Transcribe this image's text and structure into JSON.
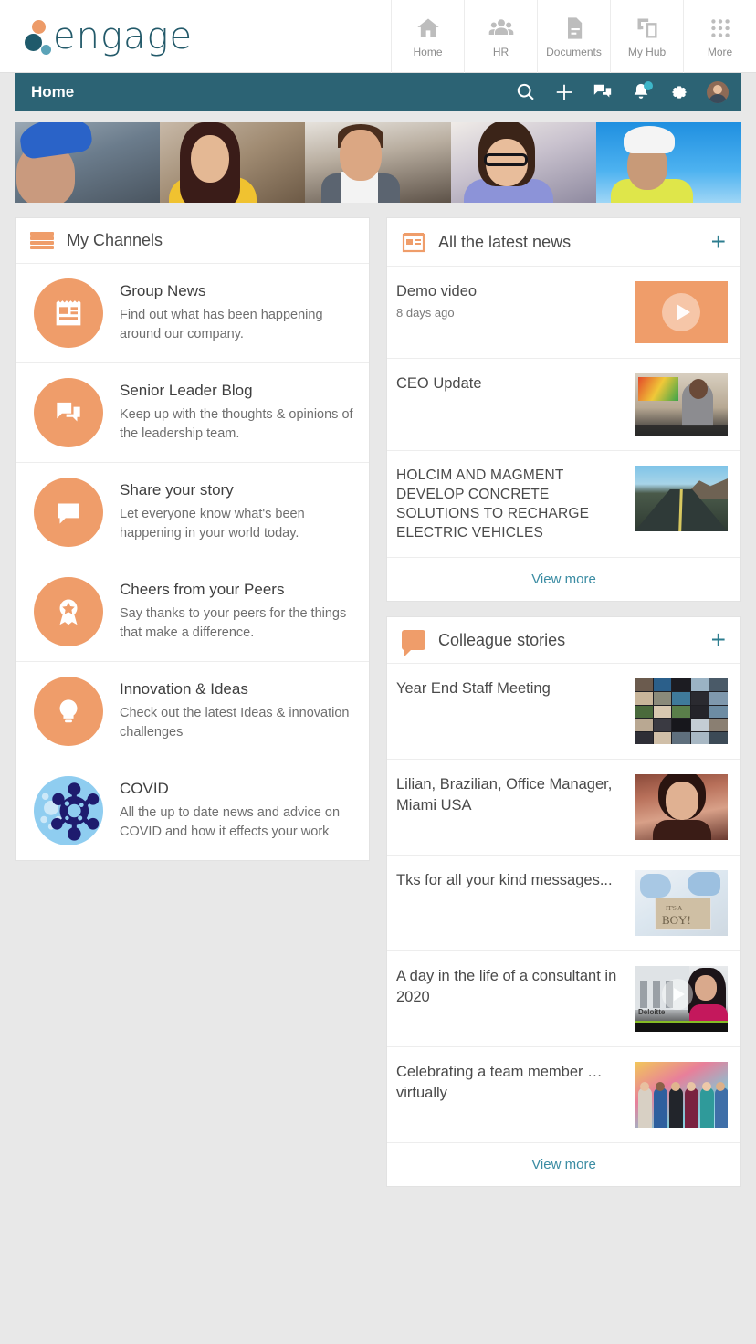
{
  "brand": {
    "name": "engage",
    "colors": {
      "orange": "#ef9d6a",
      "teal": "#2c6374",
      "link": "#3b8ca3",
      "covid_blue": "#8fcdf0"
    }
  },
  "topnav": [
    {
      "label": "Home",
      "icon": "home-icon"
    },
    {
      "label": "HR",
      "icon": "people-icon"
    },
    {
      "label": "Documents",
      "icon": "document-icon"
    },
    {
      "label": "My Hub",
      "icon": "hub-icon"
    },
    {
      "label": "More",
      "icon": "grid-dots-icon"
    }
  ],
  "pagebar": {
    "title": "Home",
    "actions": [
      {
        "name": "search-icon"
      },
      {
        "name": "add-icon"
      },
      {
        "name": "chat-icon"
      },
      {
        "name": "notifications-icon",
        "has_badge": true
      },
      {
        "name": "settings-icon"
      },
      {
        "name": "avatar"
      }
    ]
  },
  "my_channels": {
    "title": "My Channels",
    "icon": "hamburger-icon",
    "items": [
      {
        "name": "Group News",
        "desc": "Find out what has been happening around our company.",
        "icon": "newspaper-icon"
      },
      {
        "name": "Senior Leader Blog",
        "desc": "Keep up with the thoughts & opinions of the leadership team.",
        "icon": "chat-bubbles-icon"
      },
      {
        "name": "Share your story",
        "desc": "Let everyone know what's been happening in your world today.",
        "icon": "speech-bubble-icon"
      },
      {
        "name": "Cheers from your Peers",
        "desc": "Say thanks to your peers for the things that make a difference.",
        "icon": "award-rosette-icon"
      },
      {
        "name": "Innovation & Ideas",
        "desc": "Check out the latest Ideas & innovation challenges",
        "icon": "lightbulb-icon"
      },
      {
        "name": "COVID",
        "desc": "All the up to date news and advice on COVID and how it effects your work",
        "icon": "virus-icon"
      }
    ]
  },
  "latest_news": {
    "title": "All the latest news",
    "icon": "newspaper-outline-icon",
    "add_label": "+",
    "items": [
      {
        "title": "Demo video",
        "date": "8 days ago",
        "thumb": "video-placeholder"
      },
      {
        "title": "CEO Update",
        "date": "",
        "thumb": "ceo-photo"
      },
      {
        "title": "HOLCIM AND MAGMENT DEVELOP CONCRETE SOLUTIONS TO RECHARGE ELECTRIC VEHICLES",
        "date": "",
        "thumb": "road-photo"
      }
    ],
    "view_more": "View more"
  },
  "colleague_stories": {
    "title": "Colleague stories",
    "icon": "speech-bubble-icon",
    "add_label": "+",
    "items": [
      {
        "title": "Year End Staff Meeting",
        "thumb": "video-grid-photo"
      },
      {
        "title": "Lilian, Brazilian, Office Manager, Miami USA",
        "thumb": "portrait-photo"
      },
      {
        "title": "Tks for all your kind messages...",
        "thumb": "its-a-boy-photo"
      },
      {
        "title": "A day in the life of a consultant in 2020",
        "thumb": "consultant-video"
      },
      {
        "title": "Celebrating a team member … virtually",
        "thumb": "team-photo"
      }
    ],
    "view_more": "View more"
  }
}
